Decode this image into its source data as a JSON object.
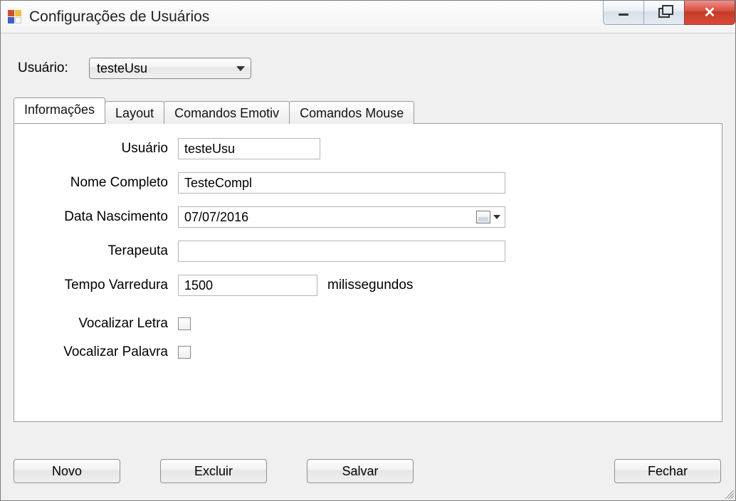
{
  "window": {
    "title": "Configurações de Usuários"
  },
  "top": {
    "user_label": "Usuário:",
    "user_value": "testeUsu"
  },
  "tabs": {
    "informacoes": "Informações",
    "layout": "Layout",
    "comandos_emotiv": "Comandos Emotiv",
    "comandos_mouse": "Comandos Mouse"
  },
  "form": {
    "usuario_label": "Usuário",
    "usuario_value": "testeUsu",
    "nome_label": "Nome Completo",
    "nome_value": "TesteCompl",
    "data_label": "Data Nascimento",
    "data_value": "07/07/2016",
    "terapeuta_label": "Terapeuta",
    "terapeuta_value": "",
    "tempo_label": "Tempo Varredura",
    "tempo_value": "1500",
    "tempo_unit": "milissegundos",
    "voc_letra_label": "Vocalizar Letra",
    "voc_palavra_label": "Vocalizar Palavra"
  },
  "buttons": {
    "novo": "Novo",
    "excluir": "Excluir",
    "salvar": "Salvar",
    "fechar": "Fechar"
  }
}
